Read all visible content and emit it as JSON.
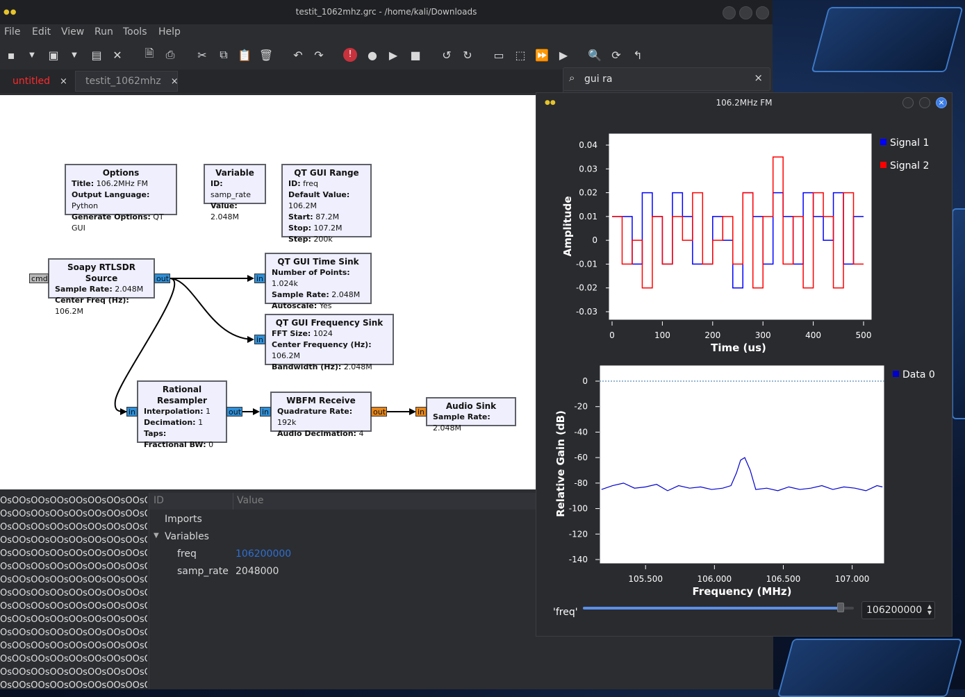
{
  "grc": {
    "window_title": "testit_1062mhz.grc - /home/kali/Downloads",
    "menu": [
      "File",
      "Edit",
      "View",
      "Run",
      "Tools",
      "Help"
    ],
    "tabs": [
      {
        "label": "untitled",
        "close": "×",
        "color": "#ff2a2a"
      },
      {
        "label": "testit_1062mhz",
        "close": "×",
        "color": "#9a9a9a"
      }
    ],
    "search": {
      "value": "gui ra",
      "clear": "×"
    },
    "blocks": {
      "options": {
        "title": "Options",
        "rows": [
          [
            "Title:",
            "106.2MHz FM"
          ],
          [
            "Output Language:",
            "Python"
          ],
          [
            "Generate Options:",
            "QT GUI"
          ]
        ]
      },
      "variable": {
        "title": "Variable",
        "rows": [
          [
            "ID:",
            "samp_rate"
          ],
          [
            "Value:",
            "2.048M"
          ]
        ]
      },
      "qt_gui_range": {
        "title": "QT GUI Range",
        "rows": [
          [
            "ID:",
            "freq"
          ],
          [
            "Default Value:",
            "106.2M"
          ],
          [
            "Start:",
            "87.2M"
          ],
          [
            "Stop:",
            "107.2M"
          ],
          [
            "Step:",
            "200k"
          ]
        ]
      },
      "soapy": {
        "title": "Soapy RTLSDR Source",
        "rows": [
          [
            "Sample Rate:",
            "2.048M"
          ],
          [
            "Center Freq (Hz):",
            "106.2M"
          ]
        ]
      },
      "time_sink": {
        "title": "QT GUI Time Sink",
        "rows": [
          [
            "Number of Points:",
            "1.024k"
          ],
          [
            "Sample Rate:",
            "2.048M"
          ],
          [
            "Autoscale:",
            "Yes"
          ]
        ]
      },
      "freq_sink": {
        "title": "QT GUI Frequency Sink",
        "rows": [
          [
            "FFT Size:",
            "1024"
          ],
          [
            "Center Frequency (Hz):",
            "106.2M"
          ],
          [
            "Bandwidth (Hz):",
            "2.048M"
          ]
        ]
      },
      "resampler": {
        "title": "Rational Resampler",
        "rows": [
          [
            "Interpolation:",
            "1"
          ],
          [
            "Decimation:",
            "1"
          ],
          [
            "Taps:",
            ""
          ],
          [
            "Fractional BW:",
            "0"
          ]
        ]
      },
      "wbfm": {
        "title": "WBFM Receive",
        "rows": [
          [
            "Quadrature Rate:",
            "192k"
          ],
          [
            "Audio Decimation:",
            "4"
          ]
        ]
      },
      "audio_sink": {
        "title": "Audio Sink",
        "rows": [
          [
            "Sample Rate:",
            "2.048M"
          ]
        ]
      }
    },
    "ports": {
      "cmd": "cmd",
      "out": "out",
      "in": "in"
    },
    "console_line": "OsOOsOOsOOsOOsOOsOOsOOsO-",
    "vars": {
      "col_id": "ID",
      "col_value": "Value",
      "imports": "Imports",
      "variables": "Variables",
      "rows": [
        {
          "id": "freq",
          "value": "106200000",
          "color": "#2f6fd0"
        },
        {
          "id": "samp_rate",
          "value": "2048000",
          "color": "#d9d9d9"
        }
      ]
    }
  },
  "qt": {
    "window_title": "106.2MHz FM",
    "close": "×",
    "slider": {
      "label": "'freq'",
      "value": "106200000",
      "fraction": 0.95
    },
    "colors": {
      "signal1": "#0000ff",
      "signal2": "#ff0000",
      "data0": "#0000cd"
    }
  },
  "chart_data": [
    {
      "type": "line",
      "xlabel": "Time (us)",
      "ylabel": "Amplitude",
      "xlim": [
        0,
        500
      ],
      "ylim": [
        -0.03,
        0.04
      ],
      "x_ticks": [
        "0",
        "100",
        "200",
        "300",
        "400",
        "500"
      ],
      "y_ticks": [
        "0.04",
        "0.03",
        "0.02",
        "0.01",
        "0",
        "-0.01",
        "-0.02",
        "-0.03"
      ],
      "legend": "right",
      "series": [
        {
          "name": "Signal 1",
          "color": "#0000ff",
          "values": [
            0.01,
            0.01,
            -0.01,
            0.02,
            0.01,
            -0.01,
            0.02,
            0.01,
            -0.01,
            -0.01,
            0.01,
            0.0,
            -0.02,
            0.02,
            0.01,
            -0.01,
            0.02,
            0.01,
            -0.01,
            0.02,
            0.01,
            0.0,
            0.02,
            -0.01,
            0.01
          ]
        },
        {
          "name": "Signal 2",
          "color": "#ff0000",
          "values": [
            0.01,
            -0.01,
            0.0,
            -0.02,
            0.01,
            -0.01,
            0.01,
            0.0,
            0.02,
            -0.01,
            0.0,
            0.01,
            -0.01,
            0.02,
            -0.02,
            0.01,
            0.035,
            -0.01,
            0.01,
            -0.02,
            0.02,
            0.01,
            -0.02,
            0.02,
            -0.01
          ]
        }
      ]
    },
    {
      "type": "line",
      "xlabel": "Frequency (MHz)",
      "ylabel": "Relative Gain (dB)",
      "xlim": [
        105.176,
        107.224
      ],
      "ylim": [
        -140,
        5
      ],
      "x_ticks": [
        "105.500",
        "106.000",
        "106.500",
        "107.000"
      ],
      "y_ticks": [
        "0",
        "-20",
        "-40",
        "-60",
        "-80",
        "-100",
        "-120",
        "-140"
      ],
      "legend": "right",
      "series": [
        {
          "name": "Data 0",
          "color": "#0000cd",
          "x": [
            105.18,
            105.26,
            105.34,
            105.42,
            105.5,
            105.58,
            105.66,
            105.74,
            105.82,
            105.9,
            105.98,
            106.06,
            106.12,
            106.16,
            106.19,
            106.22,
            106.26,
            106.3,
            106.38,
            106.46,
            106.54,
            106.62,
            106.7,
            106.78,
            106.86,
            106.94,
            107.02,
            107.1,
            107.18,
            107.22
          ],
          "values": [
            -85,
            -82,
            -80,
            -84,
            -83,
            -81,
            -86,
            -82,
            -84,
            -83,
            -85,
            -84,
            -82,
            -72,
            -62,
            -60,
            -70,
            -85,
            -84,
            -86,
            -83,
            -85,
            -84,
            -82,
            -85,
            -83,
            -84,
            -86,
            -82,
            -83
          ]
        }
      ]
    }
  ]
}
